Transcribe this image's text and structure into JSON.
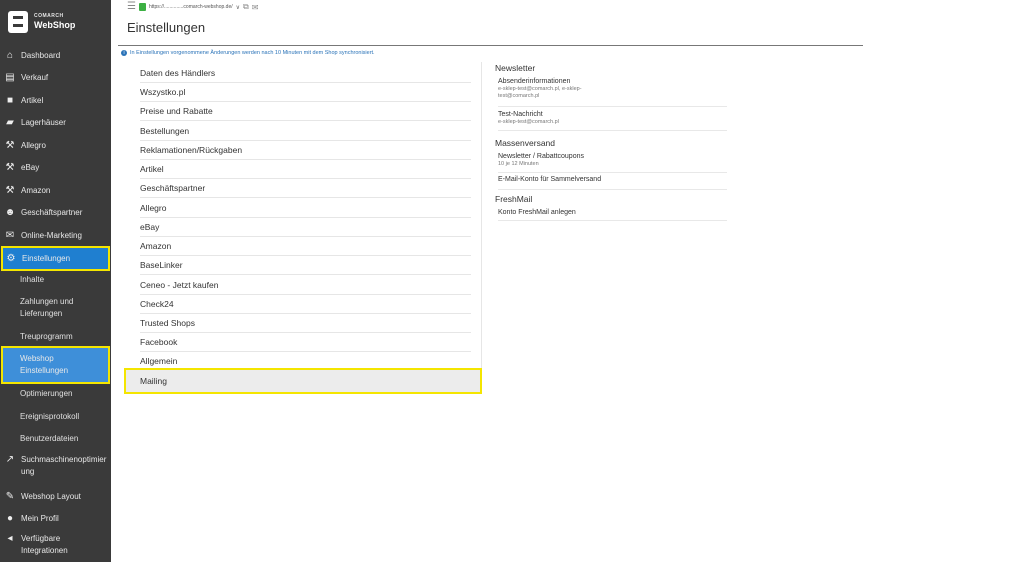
{
  "brand": {
    "small": "COMARCH",
    "big": "WebShop"
  },
  "topbar": {
    "url_text": "https://..............comarch-webshop.de/"
  },
  "page": {
    "title": "Einstellungen"
  },
  "info": {
    "text": "In Einstellungen vorgenommene Änderungen werden nach 10 Minuten mit dem Shop synchronisiert."
  },
  "sidebar": {
    "items": [
      {
        "label": "Dashboard",
        "icon": "home-icon"
      },
      {
        "label": "Verkauf",
        "icon": "document-icon"
      },
      {
        "label": "Artikel",
        "icon": "box-icon"
      },
      {
        "label": "Lagerhäuser",
        "icon": "truck-icon"
      },
      {
        "label": "Allegro",
        "icon": "gavel-icon"
      },
      {
        "label": "eBay",
        "icon": "gavel-icon"
      },
      {
        "label": "Amazon",
        "icon": "gavel-icon"
      },
      {
        "label": "Geschäftspartner",
        "icon": "users-icon"
      },
      {
        "label": "Online-Marketing",
        "icon": "envelope-icon"
      },
      {
        "label": "Einstellungen",
        "icon": "gear-icon"
      }
    ],
    "sub_items": [
      {
        "label": "Inhalte"
      },
      {
        "label": "Zahlungen und Lieferungen"
      },
      {
        "label": "Treuprogramm"
      },
      {
        "label": "Webshop Einstellungen"
      },
      {
        "label": "Optimierungen"
      },
      {
        "label": "Ereignisprotokoll"
      },
      {
        "label": "Benutzerdateien"
      }
    ],
    "bottom_items": [
      {
        "label": "Suchmaschinenoptimierung",
        "icon": "chart-icon"
      },
      {
        "label": "Webshop Layout",
        "icon": "brush-icon"
      },
      {
        "label": "Mein Profil",
        "icon": "user-icon"
      },
      {
        "label": "Verfügbare Integrationen",
        "icon": "share-icon"
      }
    ]
  },
  "settings_menu": [
    "Daten des Händlers",
    "Wszystko.pl",
    "Preise und Rabatte",
    "Bestellungen",
    "Reklamationen/Rückgaben",
    "Artikel",
    "Geschäftspartner",
    "Allegro",
    "eBay",
    "Amazon",
    "BaseLinker",
    "Ceneo - Jetzt kaufen",
    "Check24",
    "Trusted Shops",
    "Facebook",
    "Allgemein",
    "Mailing"
  ],
  "mailing": {
    "newsletter": {
      "title": "Newsletter",
      "sender_label": "Absenderinformationen",
      "sender_line1": "e-sklep-test@comarch.pl, e-sklep-",
      "sender_line2": "test@comarch.pl",
      "test_label": "Test-Nachricht",
      "test_sub": "e-sklep-test@comarch.pl"
    },
    "massenversand": {
      "title": "Massenversand",
      "coupons_label": "Newsletter / Rabattcoupons",
      "coupons_sub": "10 je 12 Minuten",
      "account_label": "E-Mail-Konto für Sammelversand"
    },
    "freshmail": {
      "title": "FreshMail",
      "create_label": "Konto FreshMail anlegen"
    }
  },
  "colors": {
    "sidebar": "#3a3a3a",
    "active": "#1f7fd0",
    "highlight": "#f4e500",
    "info": "#2a73b8"
  }
}
